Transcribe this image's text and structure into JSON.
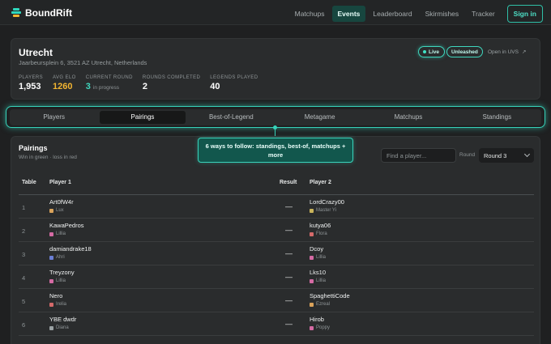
{
  "brand": {
    "name": "BoundRift"
  },
  "nav": {
    "links": [
      "Matchups",
      "Events",
      "Leaderboard",
      "Skirmishes",
      "Tracker"
    ],
    "active": "Events",
    "signin": "Sign in"
  },
  "event": {
    "title": "Utrecht",
    "address": "Jaarbeursplein 6, 3521 AZ Utrecht, Netherlands",
    "badges": {
      "live": "Live",
      "format": "Unleashed"
    },
    "open_link": "Open in UVS",
    "stats": [
      {
        "label": "PLAYERS",
        "value": "1,953"
      },
      {
        "label": "AVG ELO",
        "value": "1260"
      },
      {
        "label": "CURRENT ROUND",
        "value": "3",
        "note": "in progress"
      },
      {
        "label": "ROUNDS COMPLETED",
        "value": "2"
      },
      {
        "label": "LEGENDS PLAYED",
        "value": "40"
      }
    ]
  },
  "tabs": [
    "Players",
    "Pairings",
    "Best-of-Legend",
    "Metagame",
    "Matchups",
    "Standings"
  ],
  "active_tab": "Pairings",
  "callout": "6 ways to follow: standings, best-of, matchups + more",
  "pairings": {
    "title": "Pairings",
    "subtitle": "Win in green · loss in red",
    "search_placeholder": "Find a player...",
    "round_label": "Round",
    "round_value": "Round 3",
    "columns": [
      "Table",
      "Player 1",
      "Result",
      "Player 2"
    ],
    "rows": [
      {
        "table": "1",
        "p1": "Art0fW4r",
        "p1_legend": "Lux",
        "result": "—",
        "p2": "LordCrazy00",
        "p2_legend": "Master Yi"
      },
      {
        "table": "2",
        "p1": "KawaPedros",
        "p1_legend": "Lillia",
        "result": "—",
        "p2": "kutya06",
        "p2_legend": "Flora"
      },
      {
        "table": "3",
        "p1": "damiandrake18",
        "p1_legend": "Ahri",
        "result": "—",
        "p2": "Dcoy",
        "p2_legend": "Lillia"
      },
      {
        "table": "4",
        "p1": "Treyzony",
        "p1_legend": "Lillia",
        "result": "—",
        "p2": "Lks10",
        "p2_legend": "Lillia"
      },
      {
        "table": "5",
        "p1": "Nero",
        "p1_legend": "Irelia",
        "result": "—",
        "p2": "SpaghettiCode",
        "p2_legend": "Ezreal"
      },
      {
        "table": "6",
        "p1": "YBE dwdr",
        "p1_legend": "Diana",
        "result": "—",
        "p2": "Hirob",
        "p2_legend": "Poppy"
      }
    ]
  },
  "colors": {
    "accent": "#36d3ba",
    "gold": "#f2b531",
    "background": "#1f2021",
    "card": "#2a2c2d"
  }
}
